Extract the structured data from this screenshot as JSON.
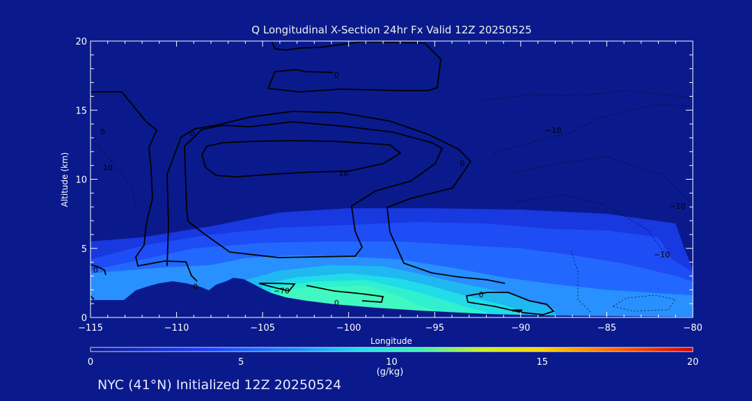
{
  "title": "Q Longitudinal X-Section 24hr  Fx Valid 12Z 20250525",
  "footer": "NYC (41°N) Initialized 12Z 20250524",
  "chart_data": {
    "type": "heatmap",
    "title": "Q Longitudinal X-Section 24hr  Fx Valid 12Z 20250525",
    "xlabel": "Longitude",
    "ylabel": "Altitude (km)",
    "xlim": [
      -115,
      -80
    ],
    "ylim": [
      0,
      20
    ],
    "x_ticks": [
      -115,
      -110,
      -105,
      -100,
      -95,
      -90,
      -85,
      -80
    ],
    "x_tick_labels": [
      "−115",
      "−110",
      "−105",
      "−100",
      "−95",
      "−90",
      "−85",
      "−80"
    ],
    "y_ticks": [
      0,
      5,
      10,
      15,
      20
    ],
    "y_tick_labels": [
      "0",
      "5",
      "10",
      "15",
      "20"
    ],
    "colorbar": {
      "range": [
        0,
        20
      ],
      "ticks": [
        0,
        5,
        10,
        15,
        20
      ],
      "tick_labels": [
        "0",
        "5",
        "10",
        "15",
        "20"
      ],
      "unit": "(g/kg)"
    },
    "contour_labels": [
      {
        "text": "0",
        "lon": -100.7,
        "alt": 17.5
      },
      {
        "text": "0",
        "lon": -114.3,
        "alt": 13.4
      },
      {
        "text": "0",
        "lon": -109.1,
        "alt": 13.3
      },
      {
        "text": "10",
        "lon": -114.0,
        "alt": 10.8
      },
      {
        "text": "10",
        "lon": -100.3,
        "alt": 10.4
      },
      {
        "text": "0",
        "lon": -93.4,
        "alt": 11.1
      },
      {
        "text": "−10",
        "lon": -88.1,
        "alt": 13.5
      },
      {
        "text": "−10",
        "lon": -80.9,
        "alt": 8.0
      },
      {
        "text": "−10",
        "lon": -81.8,
        "alt": 4.5
      },
      {
        "text": "0",
        "lon": -114.7,
        "alt": 3.4
      },
      {
        "text": "0",
        "lon": -108.9,
        "alt": 2.2
      },
      {
        "text": "−70",
        "lon": -103.9,
        "alt": 1.9
      },
      {
        "text": "0",
        "lon": -100.7,
        "alt": 1.0
      },
      {
        "text": "0",
        "lon": -92.3,
        "alt": 1.6
      }
    ],
    "moisture_layers": [
      {
        "q": 2,
        "pts": [
          [
            -115,
            5.5
          ],
          [
            -112,
            5.8
          ],
          [
            -108,
            6.6
          ],
          [
            -104,
            7.6
          ],
          [
            -100,
            7.9
          ],
          [
            -95,
            7.9
          ],
          [
            -90,
            7.8
          ],
          [
            -85,
            7.5
          ],
          [
            -81,
            6.8
          ],
          [
            -80.5,
            5
          ],
          [
            -80,
            3.5
          ]
        ]
      },
      {
        "q": 3,
        "pts": [
          [
            -115,
            4.2
          ],
          [
            -112,
            5.2
          ],
          [
            -108,
            6.0
          ],
          [
            -104,
            6.5
          ],
          [
            -100,
            6.7
          ],
          [
            -96,
            6.9
          ],
          [
            -92,
            6.8
          ],
          [
            -88,
            6.4
          ],
          [
            -85,
            6.3
          ],
          [
            -82,
            5.8
          ],
          [
            -81.2,
            4.2
          ],
          [
            -80,
            3.3
          ]
        ]
      },
      {
        "q": 4,
        "pts": [
          [
            -115,
            3.4
          ],
          [
            -112,
            4.2
          ],
          [
            -109,
            5.0
          ],
          [
            -105,
            5.4
          ],
          [
            -101,
            5.5
          ],
          [
            -97,
            5.5
          ],
          [
            -93,
            5.2
          ],
          [
            -90,
            5.0
          ],
          [
            -87,
            4.5
          ],
          [
            -84,
            3.9
          ],
          [
            -81,
            3.0
          ],
          [
            -80,
            2.6
          ]
        ]
      },
      {
        "q": 5,
        "pts": [
          [
            -115,
            3.2
          ],
          [
            -111,
            3.6
          ],
          [
            -108,
            3.8
          ],
          [
            -106,
            4.3
          ],
          [
            -103,
            4.5
          ],
          [
            -100,
            4.4
          ],
          [
            -97,
            4.2
          ],
          [
            -94,
            3.6
          ],
          [
            -91,
            2.9
          ],
          [
            -88,
            2.4
          ],
          [
            -85,
            2.0
          ],
          [
            -80,
            1.6
          ]
        ]
      },
      {
        "q": 6,
        "pts": [
          [
            -106,
            2.7
          ],
          [
            -104,
            3.4
          ],
          [
            -101,
            3.8
          ],
          [
            -98,
            3.7
          ],
          [
            -96,
            3.2
          ],
          [
            -94,
            2.6
          ],
          [
            -92,
            2.1
          ],
          [
            -90,
            1.5
          ],
          [
            -89,
            1.0
          ],
          [
            -88,
            0.6
          ]
        ]
      },
      {
        "q": 7,
        "pts": [
          [
            -105,
            2.4
          ],
          [
            -103,
            2.9
          ],
          [
            -100,
            3.2
          ],
          [
            -97,
            2.8
          ],
          [
            -95,
            2.2
          ],
          [
            -93,
            1.5
          ],
          [
            -91,
            0.9
          ],
          [
            -90,
            0.5
          ]
        ]
      },
      {
        "q": 8,
        "pts": [
          [
            -104.5,
            2.2
          ],
          [
            -102,
            2.6
          ],
          [
            -99,
            2.7
          ],
          [
            -96.5,
            2.0
          ],
          [
            -94.5,
            1.3
          ],
          [
            -93,
            0.7
          ],
          [
            -92,
            0.4
          ]
        ]
      },
      {
        "q": 9,
        "pts": [
          [
            -104,
            2.0
          ],
          [
            -101.5,
            2.2
          ],
          [
            -99,
            2.3
          ],
          [
            -97,
            1.5
          ],
          [
            -96,
            0.9
          ],
          [
            -95,
            0.5
          ]
        ]
      }
    ]
  }
}
